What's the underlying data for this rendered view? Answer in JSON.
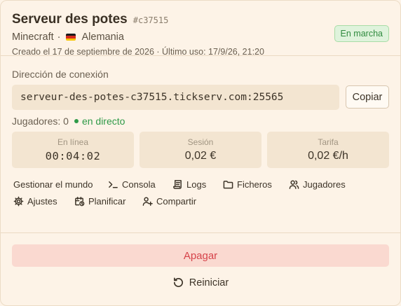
{
  "server": {
    "name": "Serveur des potes",
    "id": "#c37515",
    "game": "Minecraft",
    "separator": "·",
    "country": "Alemania",
    "flag_colors": [
      "#1a1a1a",
      "#d52b1e",
      "#f7c600"
    ],
    "meta": "Creado el 17 de septiembre de 2026 · Último uso: 17/9/26, 21:20",
    "status": "En marcha"
  },
  "connection": {
    "label": "Dirección de conexión",
    "address": "serveur-des-potes-c37515.tickserv.com:25565",
    "copy_label": "Copiar"
  },
  "players": {
    "text": "Jugadores: 0",
    "live": "en directo"
  },
  "stats": [
    {
      "label": "En línea",
      "value": "00:04:02"
    },
    {
      "label": "Sesión",
      "value": "0,02 €"
    },
    {
      "label": "Tarifa",
      "value": "0,02 €/h"
    }
  ],
  "actions": {
    "manage_world": "Gestionar el mundo",
    "console": "Consola",
    "logs": "Logs",
    "files": "Ficheros",
    "players": "Jugadores",
    "settings": "Ajustes",
    "schedule": "Planificar",
    "share": "Compartir"
  },
  "footer": {
    "stop": "Apagar",
    "restart": "Reiniciar"
  },
  "colors": {
    "background": "#fdf3e7",
    "status_green": "#2f8a3e",
    "danger": "#d6434a",
    "danger_bg": "#fad9d0"
  }
}
